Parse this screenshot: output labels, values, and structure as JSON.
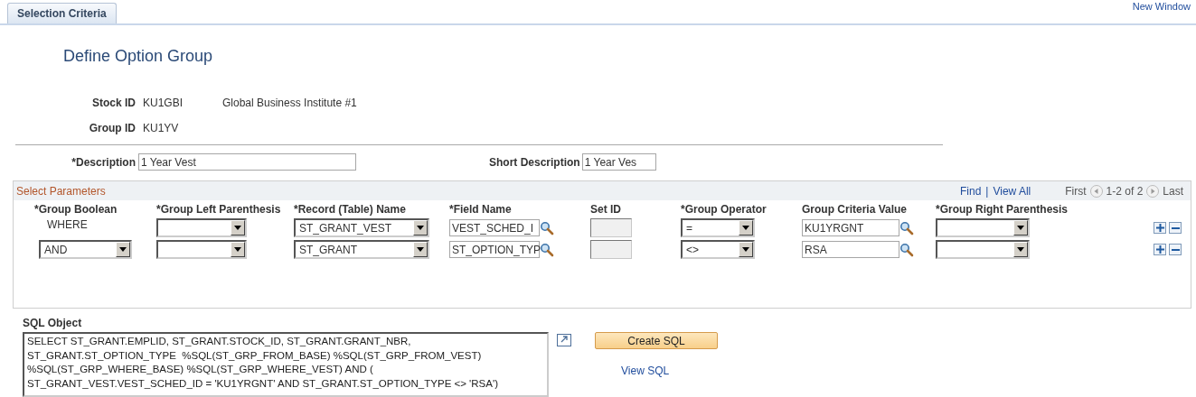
{
  "tab": {
    "label": "Selection Criteria",
    "selected": true
  },
  "new_window_link": "New Window",
  "title": "Define Option Group",
  "stock": {
    "label": "Stock ID",
    "value": "KU1GBI",
    "description": "Global Business Institute #1"
  },
  "group": {
    "label": "Group ID",
    "value": "KU1YV"
  },
  "description": {
    "label": "*Description",
    "value": "1 Year Vest"
  },
  "short_description": {
    "label": "Short Description",
    "value": "1 Year Ves"
  },
  "parameters": {
    "title": "Select Parameters",
    "find": "Find",
    "separator": "|",
    "view_all": "View All",
    "first": "First",
    "range": "1-2 of 2",
    "last": "Last",
    "columns": [
      "*Group Boolean",
      "*Group Left Parenthesis",
      "*Record (Table) Name",
      "*Field Name",
      "Set ID",
      "*Group Operator",
      "Group Criteria Value",
      "*Group Right Parenthesis"
    ],
    "rows": [
      {
        "group_boolean": {
          "kind": "text",
          "value": "WHERE"
        },
        "record": "ST_GRANT_VEST",
        "field": "VEST_SCHED_I",
        "set_id": {
          "disabled": true
        },
        "operator": "=",
        "criteria": "KU1YRGNT"
      },
      {
        "group_boolean": {
          "kind": "select",
          "value": "AND"
        },
        "record": "ST_GRANT",
        "field": "ST_OPTION_TYP",
        "set_id": {
          "disabled": true
        },
        "operator": "<>",
        "criteria": "RSA"
      }
    ]
  },
  "sql": {
    "label": "SQL Object",
    "text": "SELECT ST_GRANT.EMPLID, ST_GRANT.STOCK_ID, ST_GRANT.GRANT_NBR, ST_GRANT.ST_OPTION_TYPE  %SQL(ST_GRP_FROM_BASE) %SQL(ST_GRP_FROM_VEST) %SQL(ST_GRP_WHERE_BASE) %SQL(ST_GRP_WHERE_VEST) AND ( ST_GRANT_VEST.VEST_SCHED_ID = 'KU1YRGNT' AND ST_GRANT.ST_OPTION_TYPE <> 'RSA')",
    "create_button": "Create SQL",
    "view_link": "View SQL"
  }
}
